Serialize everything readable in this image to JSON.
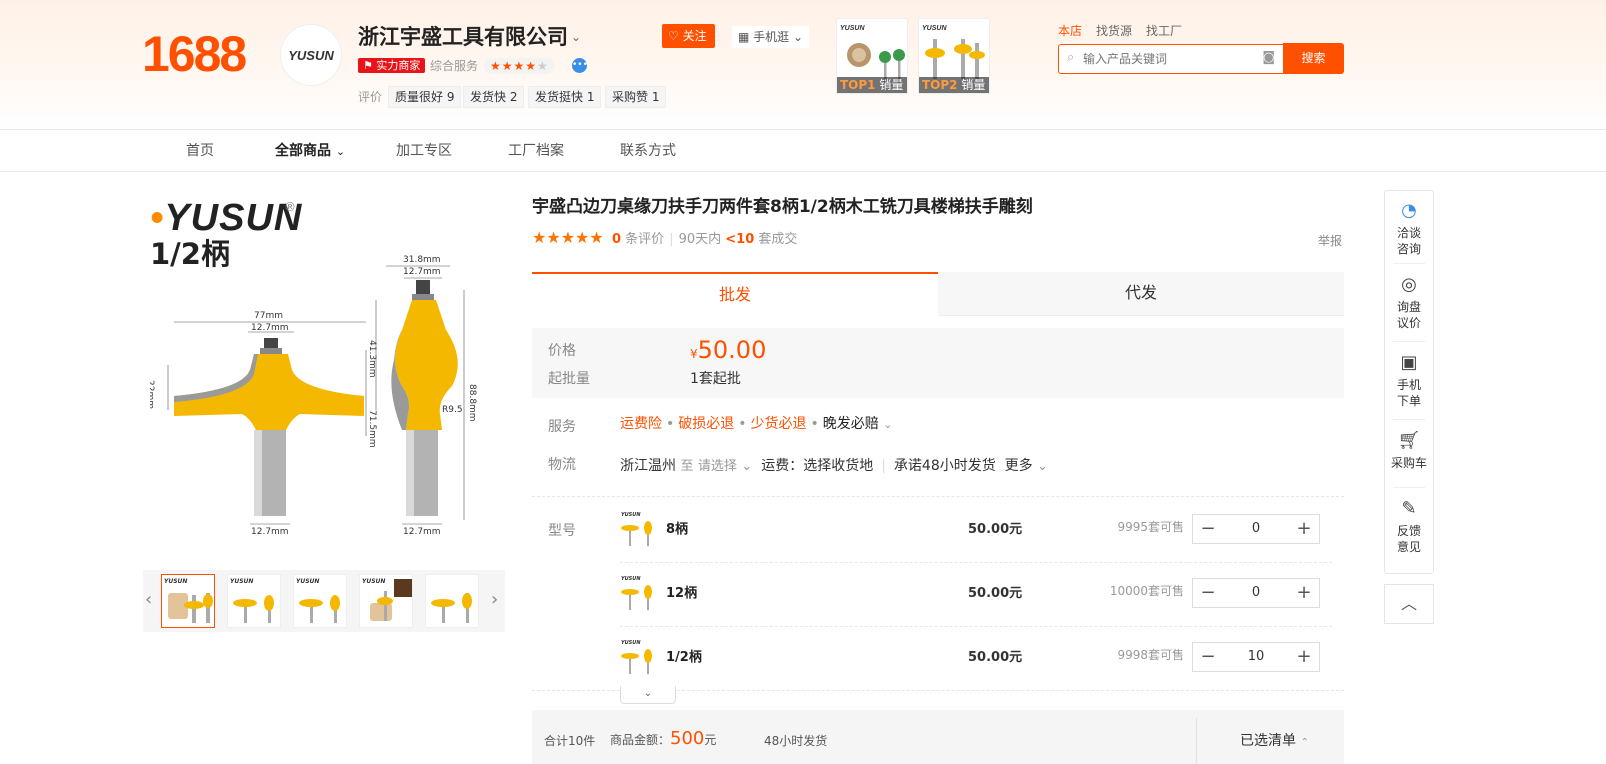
{
  "header": {
    "logo": "1688",
    "shop_logo": "YUSUN",
    "company": "浙江宇盛工具有限公司",
    "strength_badge": "实力商家",
    "service_label": "综合服务",
    "service_stars": "★★★★",
    "service_star_off": "★",
    "eval_label": "评价",
    "eval_tags": [
      "质量很好 9",
      "发货快 2",
      "发货挺快 1",
      "采购赞 1"
    ],
    "follow": "关注",
    "mobile": "手机逛",
    "top_items": [
      {
        "rank": "TOP1",
        "label": "销量"
      },
      {
        "rank": "TOP2",
        "label": "销量"
      }
    ]
  },
  "search": {
    "tabs": [
      "本店",
      "找货源",
      "找工厂"
    ],
    "placeholder": "输入产品关键词",
    "button": "搜索"
  },
  "nav": {
    "items": [
      "首页",
      "全部商品",
      "加工专区",
      "工厂档案",
      "联系方式"
    ]
  },
  "gallery": {
    "brand": "YUSUN",
    "handle": "1/2柄",
    "dims": {
      "left_width": "77mm",
      "left_bore": "12.7mm",
      "left_height": "22mm",
      "left_shank": "12.7mm",
      "right_top": "31.8mm",
      "right_bore": "12.7mm",
      "right_mid": "41.3mm",
      "right_len": "71.5mm",
      "right_total": "88.8mm",
      "right_radius": "R9.5",
      "right_shank": "12.7mm"
    },
    "thumb_count": 5,
    "thumb_brand": "YUSUN"
  },
  "product": {
    "title": "宇盛凸边刀桌缘刀扶手刀两件套8柄1/2柄木工铣刀具楼梯扶手雕刻",
    "stars": "★★★★★",
    "review_count": "0",
    "review_label": "条评价",
    "days": "90天内",
    "deals": "<10",
    "deals_label": "套成交",
    "report": "举报",
    "tabs": [
      "批发",
      "代发"
    ],
    "price_label": "价格",
    "currency": "¥",
    "price": "50.00",
    "moq_label": "起批量",
    "moq": "1套起批",
    "service_label": "服务",
    "services": [
      "运费险",
      "破损必退",
      "少货必退",
      "晚发必赔"
    ],
    "logistics_label": "物流",
    "origin": "浙江温州",
    "to": "至",
    "select": "请选择",
    "shipping": "运费：选择收货地",
    "promise": "承诺48小时发货",
    "more": "更多",
    "sku_label": "型号",
    "skus": [
      {
        "name": "8柄",
        "price": "50.00元",
        "stock": "9995套可售",
        "qty": "0"
      },
      {
        "name": "12柄",
        "price": "50.00元",
        "stock": "10000套可售",
        "qty": "0"
      },
      {
        "name": "1/2柄",
        "price": "50.00元",
        "stock": "9998套可售",
        "qty": "10"
      }
    ]
  },
  "footer": {
    "total": "合计10件",
    "amount_label": "商品金额：",
    "amount": "500",
    "amount_unit": "元",
    "ship": "48小时发货",
    "list": "已选清单"
  },
  "sidebar": {
    "items": [
      "洽谈咨询",
      "询盘议价",
      "手机下单",
      "采购车",
      "反馈意见"
    ]
  },
  "colors": {
    "accent": "#ff5000",
    "tool_yellow": "#f5b800"
  }
}
